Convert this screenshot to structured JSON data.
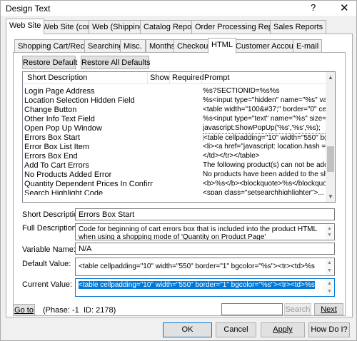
{
  "window": {
    "title": "Design Text",
    "help_glyph": "?",
    "close_glyph": "✕"
  },
  "tabs_top": [
    "Web Site",
    "Web Site (cont)",
    "Web (Shipping)",
    "Catalog Reports",
    "Order Processing Reports",
    "Sales Reports"
  ],
  "tabs_sub": [
    "Shopping Cart/Receipt",
    "Searching",
    "Misc.",
    "Months",
    "Checkout",
    "HTML",
    "Customer Accounts",
    "E-mail"
  ],
  "buttons": {
    "restore_default": "Restore Default",
    "restore_all": "Restore All Defaults"
  },
  "list": {
    "columns": [
      "Short Description",
      "Show",
      "Required",
      "Prompt"
    ],
    "rows": [
      {
        "desc": "Login Page Address",
        "prompt": "%s?SECTIONID=%s%s"
      },
      {
        "desc": "Location Selection Hidden Field",
        "prompt": "%s<input type=\"hidden\" name=\"%s\" valu..."
      },
      {
        "desc": "Change Button",
        "prompt": "<table width=\"100&#37;\" border=\"0\" cell..."
      },
      {
        "desc": "Other Info Text Field",
        "prompt": "%s<input type=\"text\" name=\"%s\" size=\"%..."
      },
      {
        "desc": "Open Pop Up Window",
        "prompt": "javascript:ShowPopUp('%s','%s',%s);"
      },
      {
        "desc": "Errors Box Start",
        "prompt": "<table cellpadding=\"10\" width=\"550\" bor..."
      },
      {
        "desc": "Error Box List Item",
        "prompt": "<li><a  href=\"javascript: location.hash = 'a..."
      },
      {
        "desc": "Errors Box End",
        "prompt": "</td></tr></table>"
      },
      {
        "desc": "Add To Cart Errors",
        "prompt": "The following product(s) can not be added..."
      },
      {
        "desc": "No Products Added Error",
        "prompt": "No products have been added to the shop..."
      },
      {
        "desc": "Quantity Dependent Prices In Confirmatio...",
        "prompt": "<b>%s</b><blockquote>%s</blockquote>"
      },
      {
        "desc": "Search Highlight Code",
        "prompt": "<span class=\"setsearchhighlighter\">..."
      }
    ]
  },
  "details": {
    "short_desc_label": "Short Description:",
    "short_desc_value": "Errors Box Start",
    "full_desc_label": "Full Description:",
    "full_desc_value": "Code for beginning of cart errors box that is included into the product HTML when using a shopping mode of 'Quantity on Product Page'",
    "var_name_label": "Variable Name:",
    "var_name_value": "N/A",
    "default_label": "Default Value:",
    "default_value": "<table cellpadding=\"10\" width=\"550\" border=\"1\" bgcolor=\"%s\"><tr><td>%s",
    "current_label": "Current Value:",
    "current_value": "<table cellpadding=\"10\" width=\"550\" border=\"1\" bgcolor=\"%s\"><tr><td>%s"
  },
  "footer": {
    "goto": "Go to",
    "phase": "(Phase: -1",
    "id": "ID: 2178)",
    "search_placeholder": "",
    "search": "Search",
    "next": "Next"
  },
  "dialog_buttons": {
    "ok": "OK",
    "cancel": "Cancel",
    "apply": "Apply",
    "howdoi": "How Do I?"
  },
  "colors": {
    "accent": "#0078d7",
    "selection": "#0078d7"
  }
}
